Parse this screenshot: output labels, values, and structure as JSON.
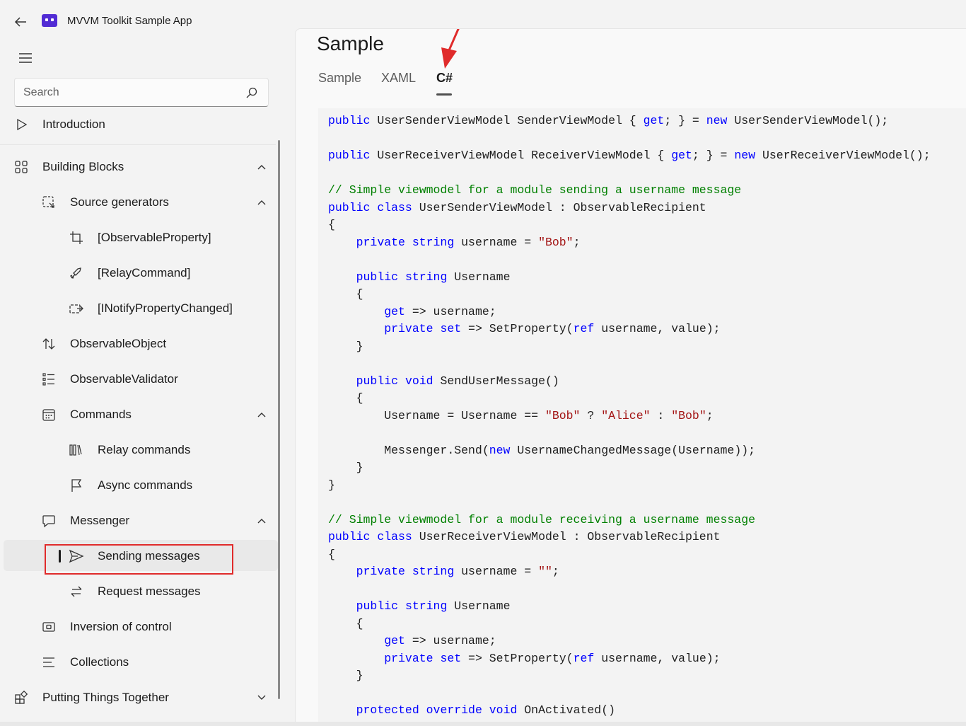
{
  "app": {
    "title": "MVVM Toolkit Sample App"
  },
  "search": {
    "placeholder": "Search"
  },
  "nav": {
    "introduction": "Introduction",
    "building_blocks": "Building Blocks",
    "source_generators": "Source generators",
    "observable_property": "[ObservableProperty]",
    "relay_command": "[RelayCommand]",
    "inotify": "[INotifyPropertyChanged]",
    "observable_object": "ObservableObject",
    "observable_validator": "ObservableValidator",
    "commands": "Commands",
    "relay_commands": "Relay commands",
    "async_commands": "Async commands",
    "messenger": "Messenger",
    "sending_messages": "Sending messages",
    "request_messages": "Request messages",
    "inversion_of_control": "Inversion of control",
    "collections": "Collections",
    "putting_together": "Putting Things Together",
    "selected": "Sending messages"
  },
  "page": {
    "title": "Sample",
    "tabs": [
      "Sample",
      "XAML",
      "C#"
    ],
    "active_tab": "C#"
  },
  "code": [
    [
      [
        "kw",
        "public"
      ],
      [
        "t",
        " UserSenderViewModel SenderViewModel { "
      ],
      [
        "kw",
        "get"
      ],
      [
        "t",
        "; } = "
      ],
      [
        "kw",
        "new"
      ],
      [
        "t",
        " UserSenderViewModel();"
      ]
    ],
    [],
    [
      [
        "kw",
        "public"
      ],
      [
        "t",
        " UserReceiverViewModel ReceiverViewModel { "
      ],
      [
        "kw",
        "get"
      ],
      [
        "t",
        "; } = "
      ],
      [
        "kw",
        "new"
      ],
      [
        "t",
        " UserReceiverViewModel();"
      ]
    ],
    [],
    [
      [
        "cm",
        "// Simple viewmodel for a module sending a username message"
      ]
    ],
    [
      [
        "kw",
        "public"
      ],
      [
        "t",
        " "
      ],
      [
        "kw",
        "class"
      ],
      [
        "t",
        " UserSenderViewModel : ObservableRecipient"
      ]
    ],
    [
      [
        "t",
        "{"
      ]
    ],
    [
      [
        "t",
        "    "
      ],
      [
        "kw",
        "private"
      ],
      [
        "t",
        " "
      ],
      [
        "kw",
        "string"
      ],
      [
        "t",
        " username = "
      ],
      [
        "str",
        "\"Bob\""
      ],
      [
        "t",
        ";"
      ]
    ],
    [],
    [
      [
        "t",
        "    "
      ],
      [
        "kw",
        "public"
      ],
      [
        "t",
        " "
      ],
      [
        "kw",
        "string"
      ],
      [
        "t",
        " Username"
      ]
    ],
    [
      [
        "t",
        "    {"
      ]
    ],
    [
      [
        "t",
        "        "
      ],
      [
        "kw",
        "get"
      ],
      [
        "t",
        " => username;"
      ]
    ],
    [
      [
        "t",
        "        "
      ],
      [
        "kw",
        "private"
      ],
      [
        "t",
        " "
      ],
      [
        "kw",
        "set"
      ],
      [
        "t",
        " => SetProperty("
      ],
      [
        "kw",
        "ref"
      ],
      [
        "t",
        " username, value);"
      ]
    ],
    [
      [
        "t",
        "    }"
      ]
    ],
    [],
    [
      [
        "t",
        "    "
      ],
      [
        "kw",
        "public"
      ],
      [
        "t",
        " "
      ],
      [
        "kw",
        "void"
      ],
      [
        "t",
        " SendUserMessage()"
      ]
    ],
    [
      [
        "t",
        "    {"
      ]
    ],
    [
      [
        "t",
        "        Username = Username == "
      ],
      [
        "str",
        "\"Bob\""
      ],
      [
        "t",
        " ? "
      ],
      [
        "str",
        "\"Alice\""
      ],
      [
        "t",
        " : "
      ],
      [
        "str",
        "\"Bob\""
      ],
      [
        "t",
        ";"
      ]
    ],
    [],
    [
      [
        "t",
        "        Messenger.Send("
      ],
      [
        "kw",
        "new"
      ],
      [
        "t",
        " UsernameChangedMessage(Username));"
      ]
    ],
    [
      [
        "t",
        "    }"
      ]
    ],
    [
      [
        "t",
        "}"
      ]
    ],
    [],
    [
      [
        "cm",
        "// Simple viewmodel for a module receiving a username message"
      ]
    ],
    [
      [
        "kw",
        "public"
      ],
      [
        "t",
        " "
      ],
      [
        "kw",
        "class"
      ],
      [
        "t",
        " UserReceiverViewModel : ObservableRecipient"
      ]
    ],
    [
      [
        "t",
        "{"
      ]
    ],
    [
      [
        "t",
        "    "
      ],
      [
        "kw",
        "private"
      ],
      [
        "t",
        " "
      ],
      [
        "kw",
        "string"
      ],
      [
        "t",
        " username = "
      ],
      [
        "str",
        "\"\""
      ],
      [
        "t",
        ";"
      ]
    ],
    [],
    [
      [
        "t",
        "    "
      ],
      [
        "kw",
        "public"
      ],
      [
        "t",
        " "
      ],
      [
        "kw",
        "string"
      ],
      [
        "t",
        " Username"
      ]
    ],
    [
      [
        "t",
        "    {"
      ]
    ],
    [
      [
        "t",
        "        "
      ],
      [
        "kw",
        "get"
      ],
      [
        "t",
        " => username;"
      ]
    ],
    [
      [
        "t",
        "        "
      ],
      [
        "kw",
        "private"
      ],
      [
        "t",
        " "
      ],
      [
        "kw",
        "set"
      ],
      [
        "t",
        " => SetProperty("
      ],
      [
        "kw",
        "ref"
      ],
      [
        "t",
        " username, value);"
      ]
    ],
    [
      [
        "t",
        "    }"
      ]
    ],
    [],
    [
      [
        "t",
        "    "
      ],
      [
        "kw",
        "protected"
      ],
      [
        "t",
        " "
      ],
      [
        "kw",
        "override"
      ],
      [
        "t",
        " "
      ],
      [
        "kw",
        "void"
      ],
      [
        "t",
        " OnActivated()"
      ]
    ]
  ],
  "colors": {
    "keyword": "#0000ff",
    "string": "#a31515",
    "comment": "#008000",
    "highlight_box": "#e02b2b",
    "arrow": "#e02b2b"
  }
}
